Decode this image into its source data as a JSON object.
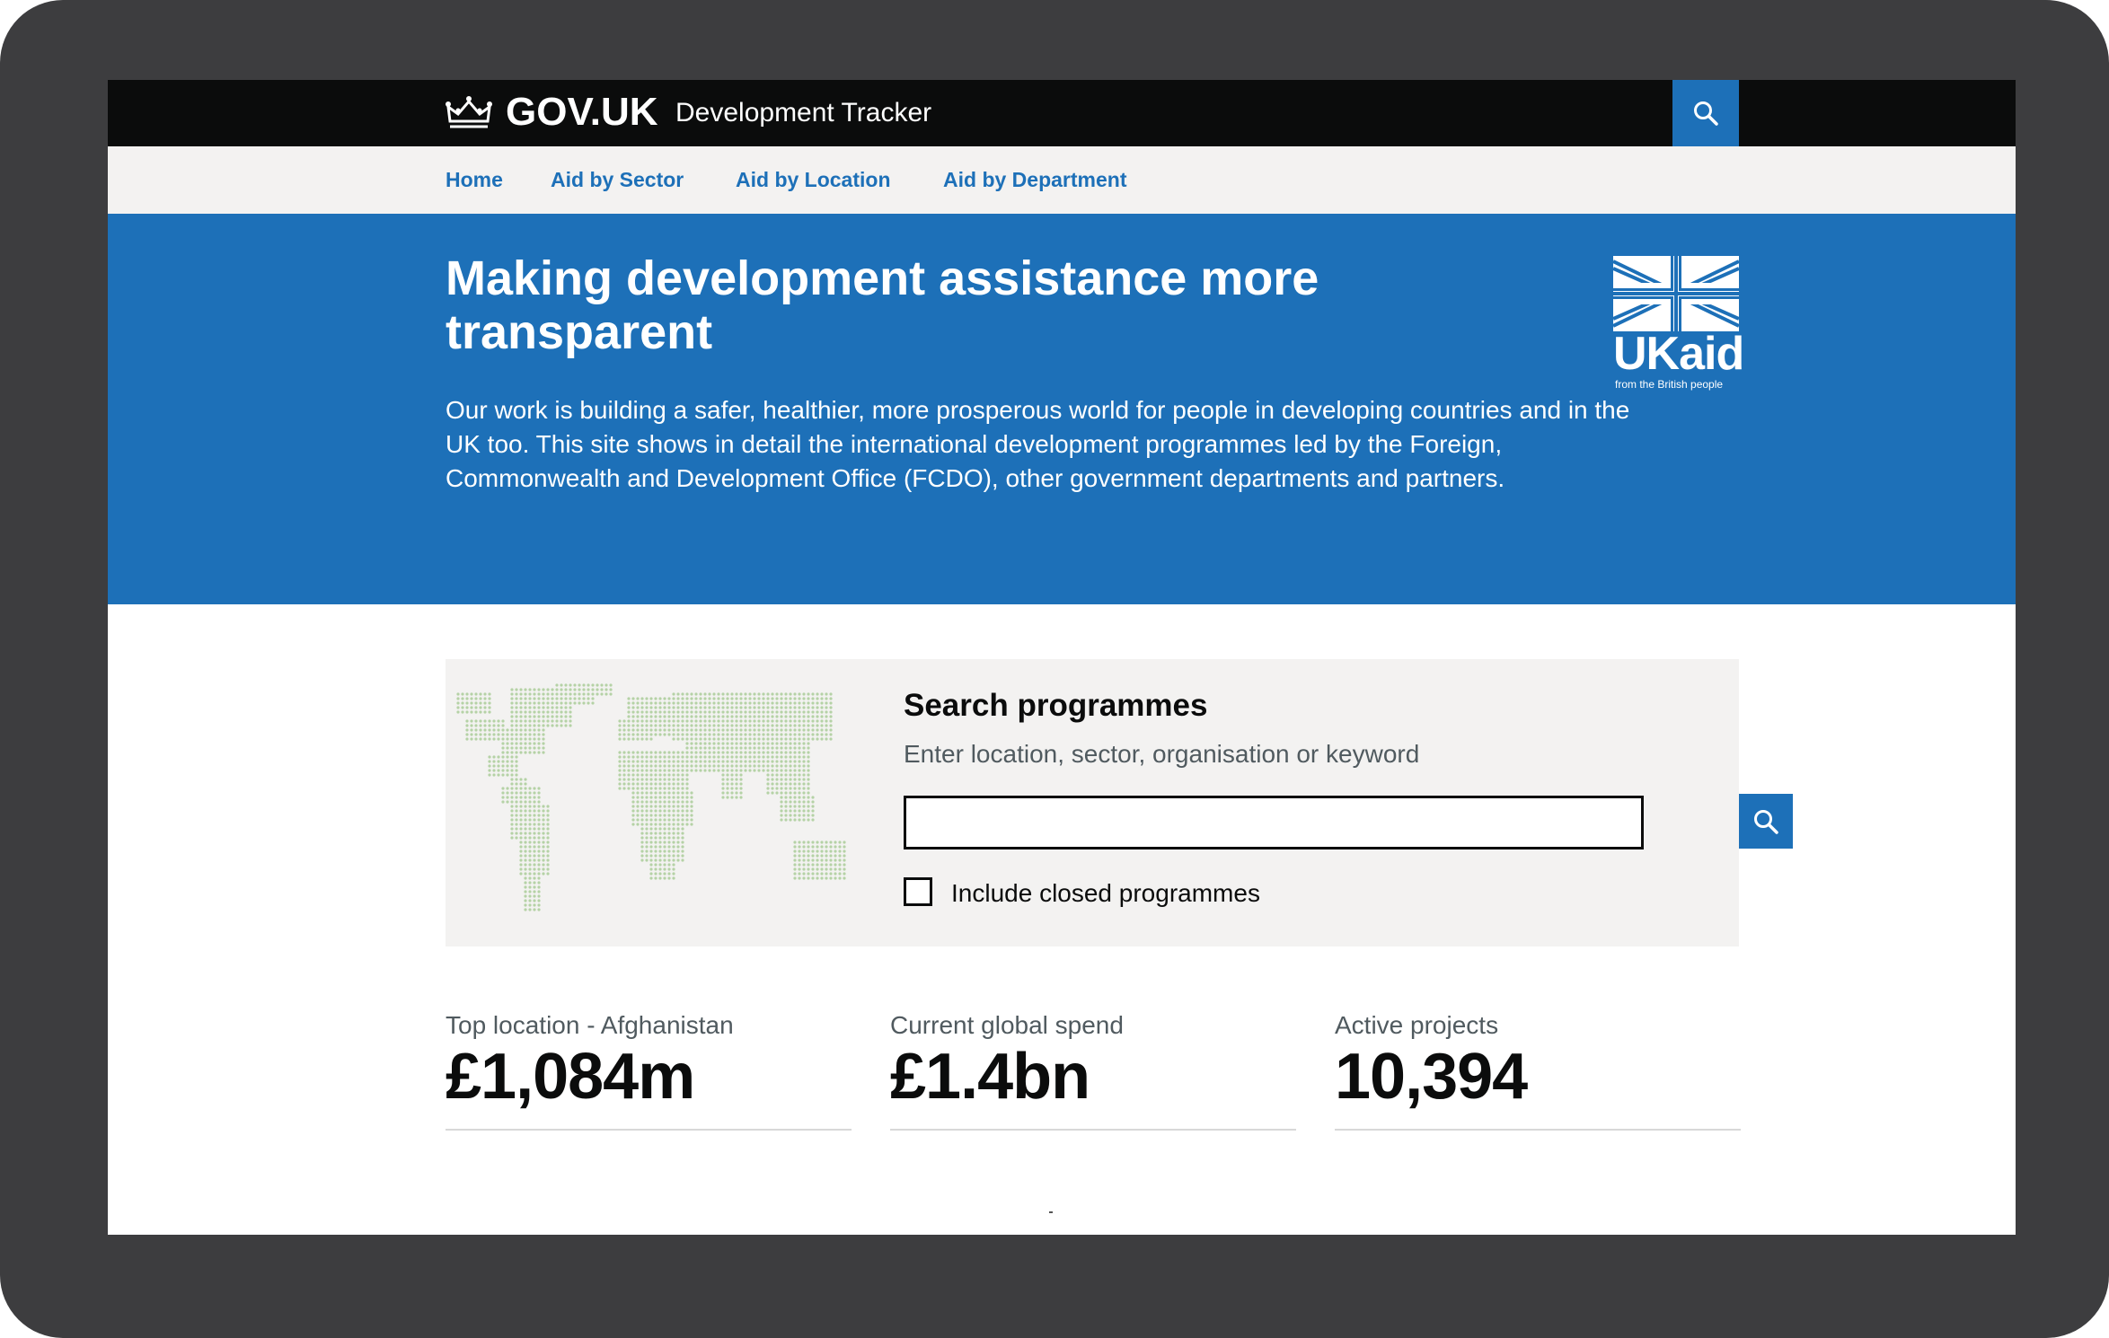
{
  "header": {
    "brand": "GOV.UK",
    "service": "Development Tracker"
  },
  "nav": {
    "items": [
      {
        "label": "Home"
      },
      {
        "label": "Aid by Sector"
      },
      {
        "label": "Aid by Location"
      },
      {
        "label": "Aid by Department"
      }
    ]
  },
  "hero": {
    "title": "Making development assistance more transparent",
    "description": "Our work is building a safer, healthier, more prosperous world for people in developing countries and in the UK too. This site shows in detail the international development programmes led by the Foreign, Commonwealth and Development Office (FCDO), other government departments and partners.",
    "logo_word": "UKaid",
    "logo_tagline": "from the British people"
  },
  "search": {
    "title": "Search programmes",
    "hint": "Enter location, sector, organisation or keyword",
    "value": "",
    "placeholder": "",
    "include_closed_label": "Include closed programmes",
    "include_closed_checked": false
  },
  "stats": [
    {
      "label": "Top location - Afghanistan",
      "value": "£1,084m"
    },
    {
      "label": "Current global spend",
      "value": "£1.4bn"
    },
    {
      "label": "Active projects",
      "value": "10,394"
    }
  ],
  "colors": {
    "header_bg": "#0b0c0c",
    "accent_blue": "#1d70b8",
    "panel_bg": "#f3f2f1",
    "map_dots": "#b5d2a6"
  },
  "icons": {
    "header_search": "search-icon",
    "crown": "crown-icon",
    "submit_search": "search-icon"
  }
}
